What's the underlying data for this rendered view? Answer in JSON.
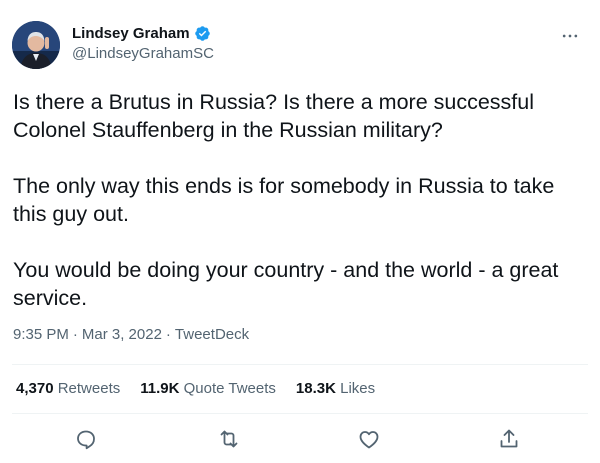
{
  "author": {
    "display_name": "Lindsey Graham",
    "handle": "@LindseyGrahamSC",
    "verified": true
  },
  "tweet": {
    "paragraphs": [
      "Is there a Brutus in Russia?  Is there a more successful Colonel Stauffenberg in the Russian military?",
      "The only way this ends is for somebody in Russia to take this guy out.",
      "You would be doing your country - and the world - a great service."
    ],
    "time": "9:35 PM",
    "date": "Mar 3, 2022",
    "source": "TweetDeck",
    "separator": "·"
  },
  "stats": {
    "retweets_count": "4,370",
    "retweets_label": "Retweets",
    "quotes_count": "11.9K",
    "quotes_label": "Quote Tweets",
    "likes_count": "18.3K",
    "likes_label": "Likes"
  },
  "icons": {
    "more": "more-horizontal-icon",
    "verified": "verified-badge-icon",
    "reply": "reply-icon",
    "retweet": "retweet-icon",
    "like": "heart-icon",
    "share": "share-icon"
  },
  "colors": {
    "text": "#0f1419",
    "secondary": "#536471",
    "verified": "#1d9bf0",
    "divider": "#eff3f4"
  }
}
